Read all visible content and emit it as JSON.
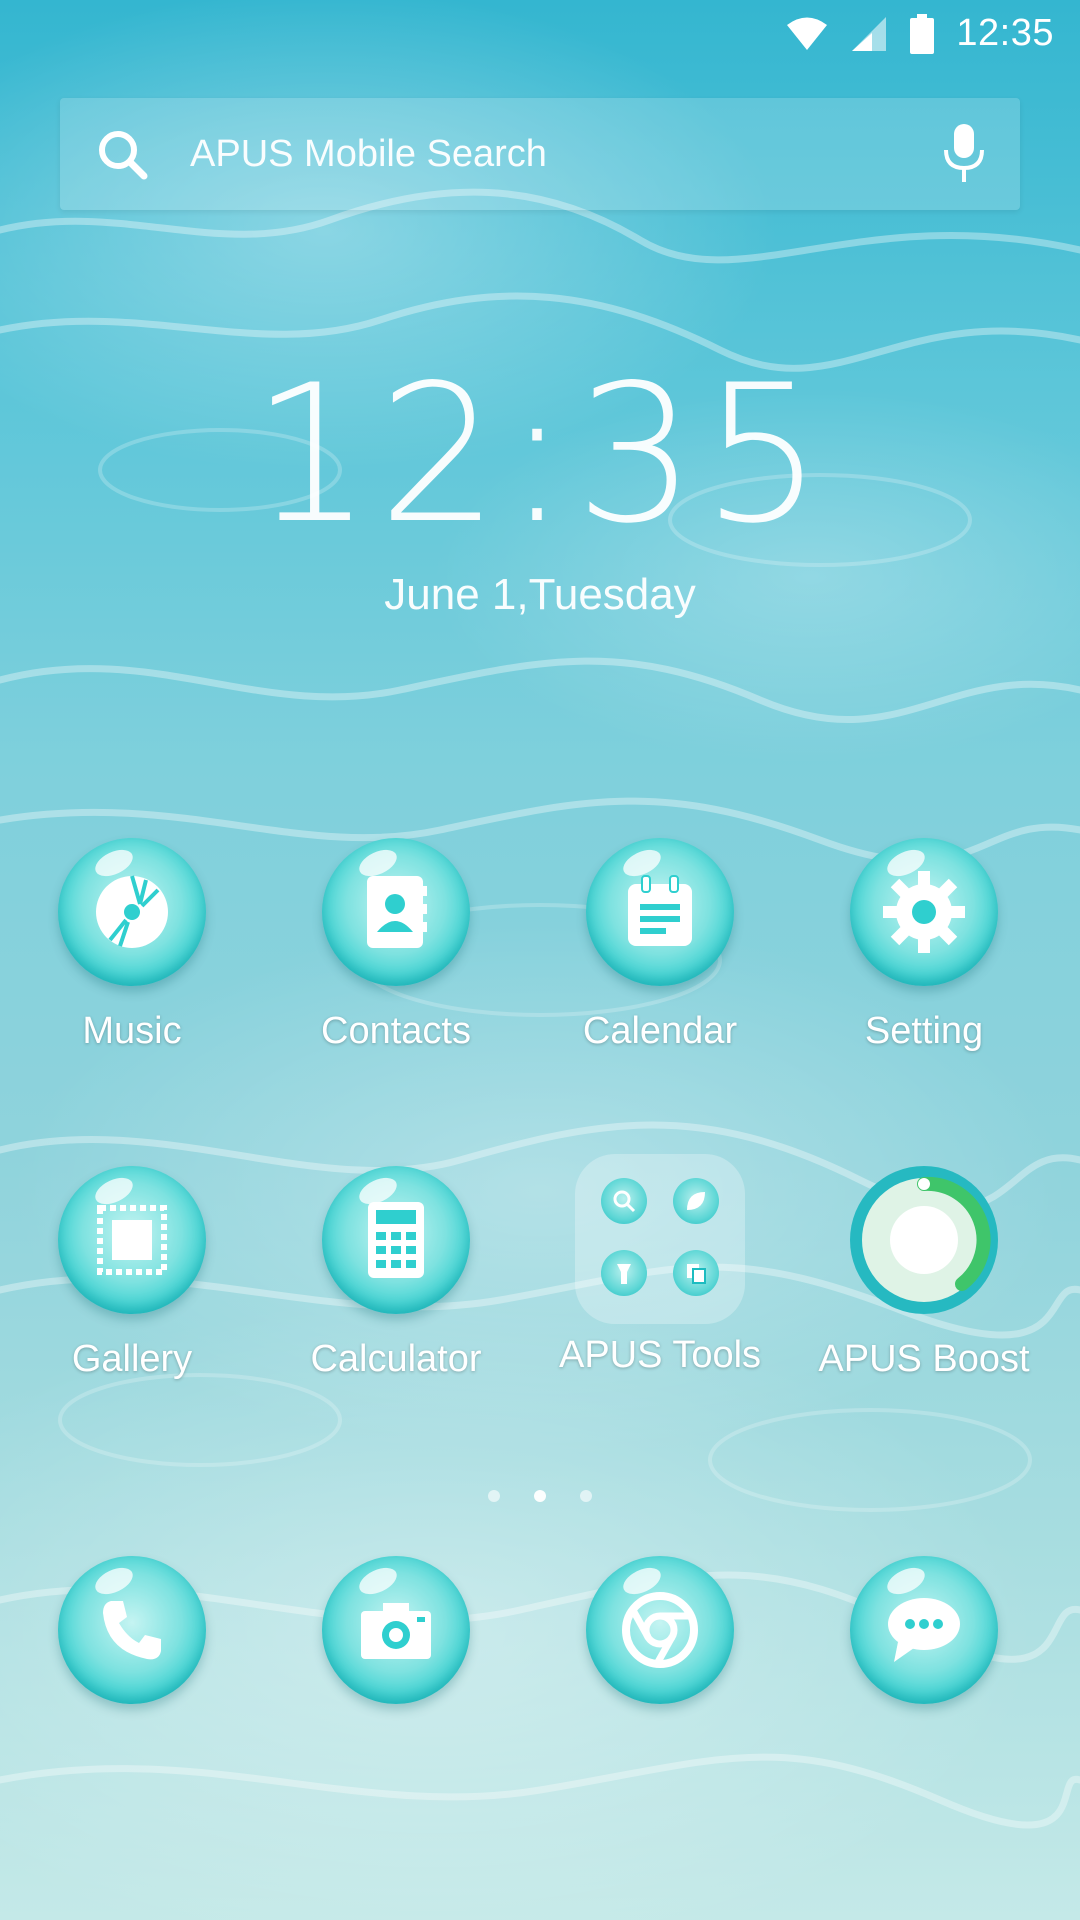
{
  "status_bar": {
    "time": "12:35",
    "icons": [
      "wifi-icon",
      "cell-signal-icon",
      "battery-icon"
    ]
  },
  "search": {
    "placeholder": "APUS Mobile Search",
    "icons": [
      "search-icon",
      "mic-icon"
    ]
  },
  "clock_widget": {
    "time": "12:35",
    "date": "June 1,Tuesday"
  },
  "apps_row1": [
    {
      "label": "Music",
      "icon": "music-disc-icon"
    },
    {
      "label": "Contacts",
      "icon": "contacts-book-icon"
    },
    {
      "label": "Calendar",
      "icon": "calendar-icon"
    },
    {
      "label": "Setting",
      "icon": "gear-icon"
    }
  ],
  "apps_row2": [
    {
      "label": "Gallery",
      "icon": "gallery-stamp-icon"
    },
    {
      "label": "Calculator",
      "icon": "calculator-icon"
    },
    {
      "label": "APUS Tools",
      "icon": "folder-icon"
    },
    {
      "label": "APUS Boost",
      "icon": "boost-ring-icon"
    }
  ],
  "page_indicator": {
    "count": 3,
    "active": 1
  },
  "dock": [
    {
      "icon": "phone-icon"
    },
    {
      "icon": "camera-icon"
    },
    {
      "icon": "browser-icon"
    },
    {
      "icon": "message-bubble-icon"
    }
  ],
  "colors": {
    "bubble": "#2fcfcf",
    "boost_ring": "#26b9c1",
    "boost_arc": "#3fc56a"
  }
}
